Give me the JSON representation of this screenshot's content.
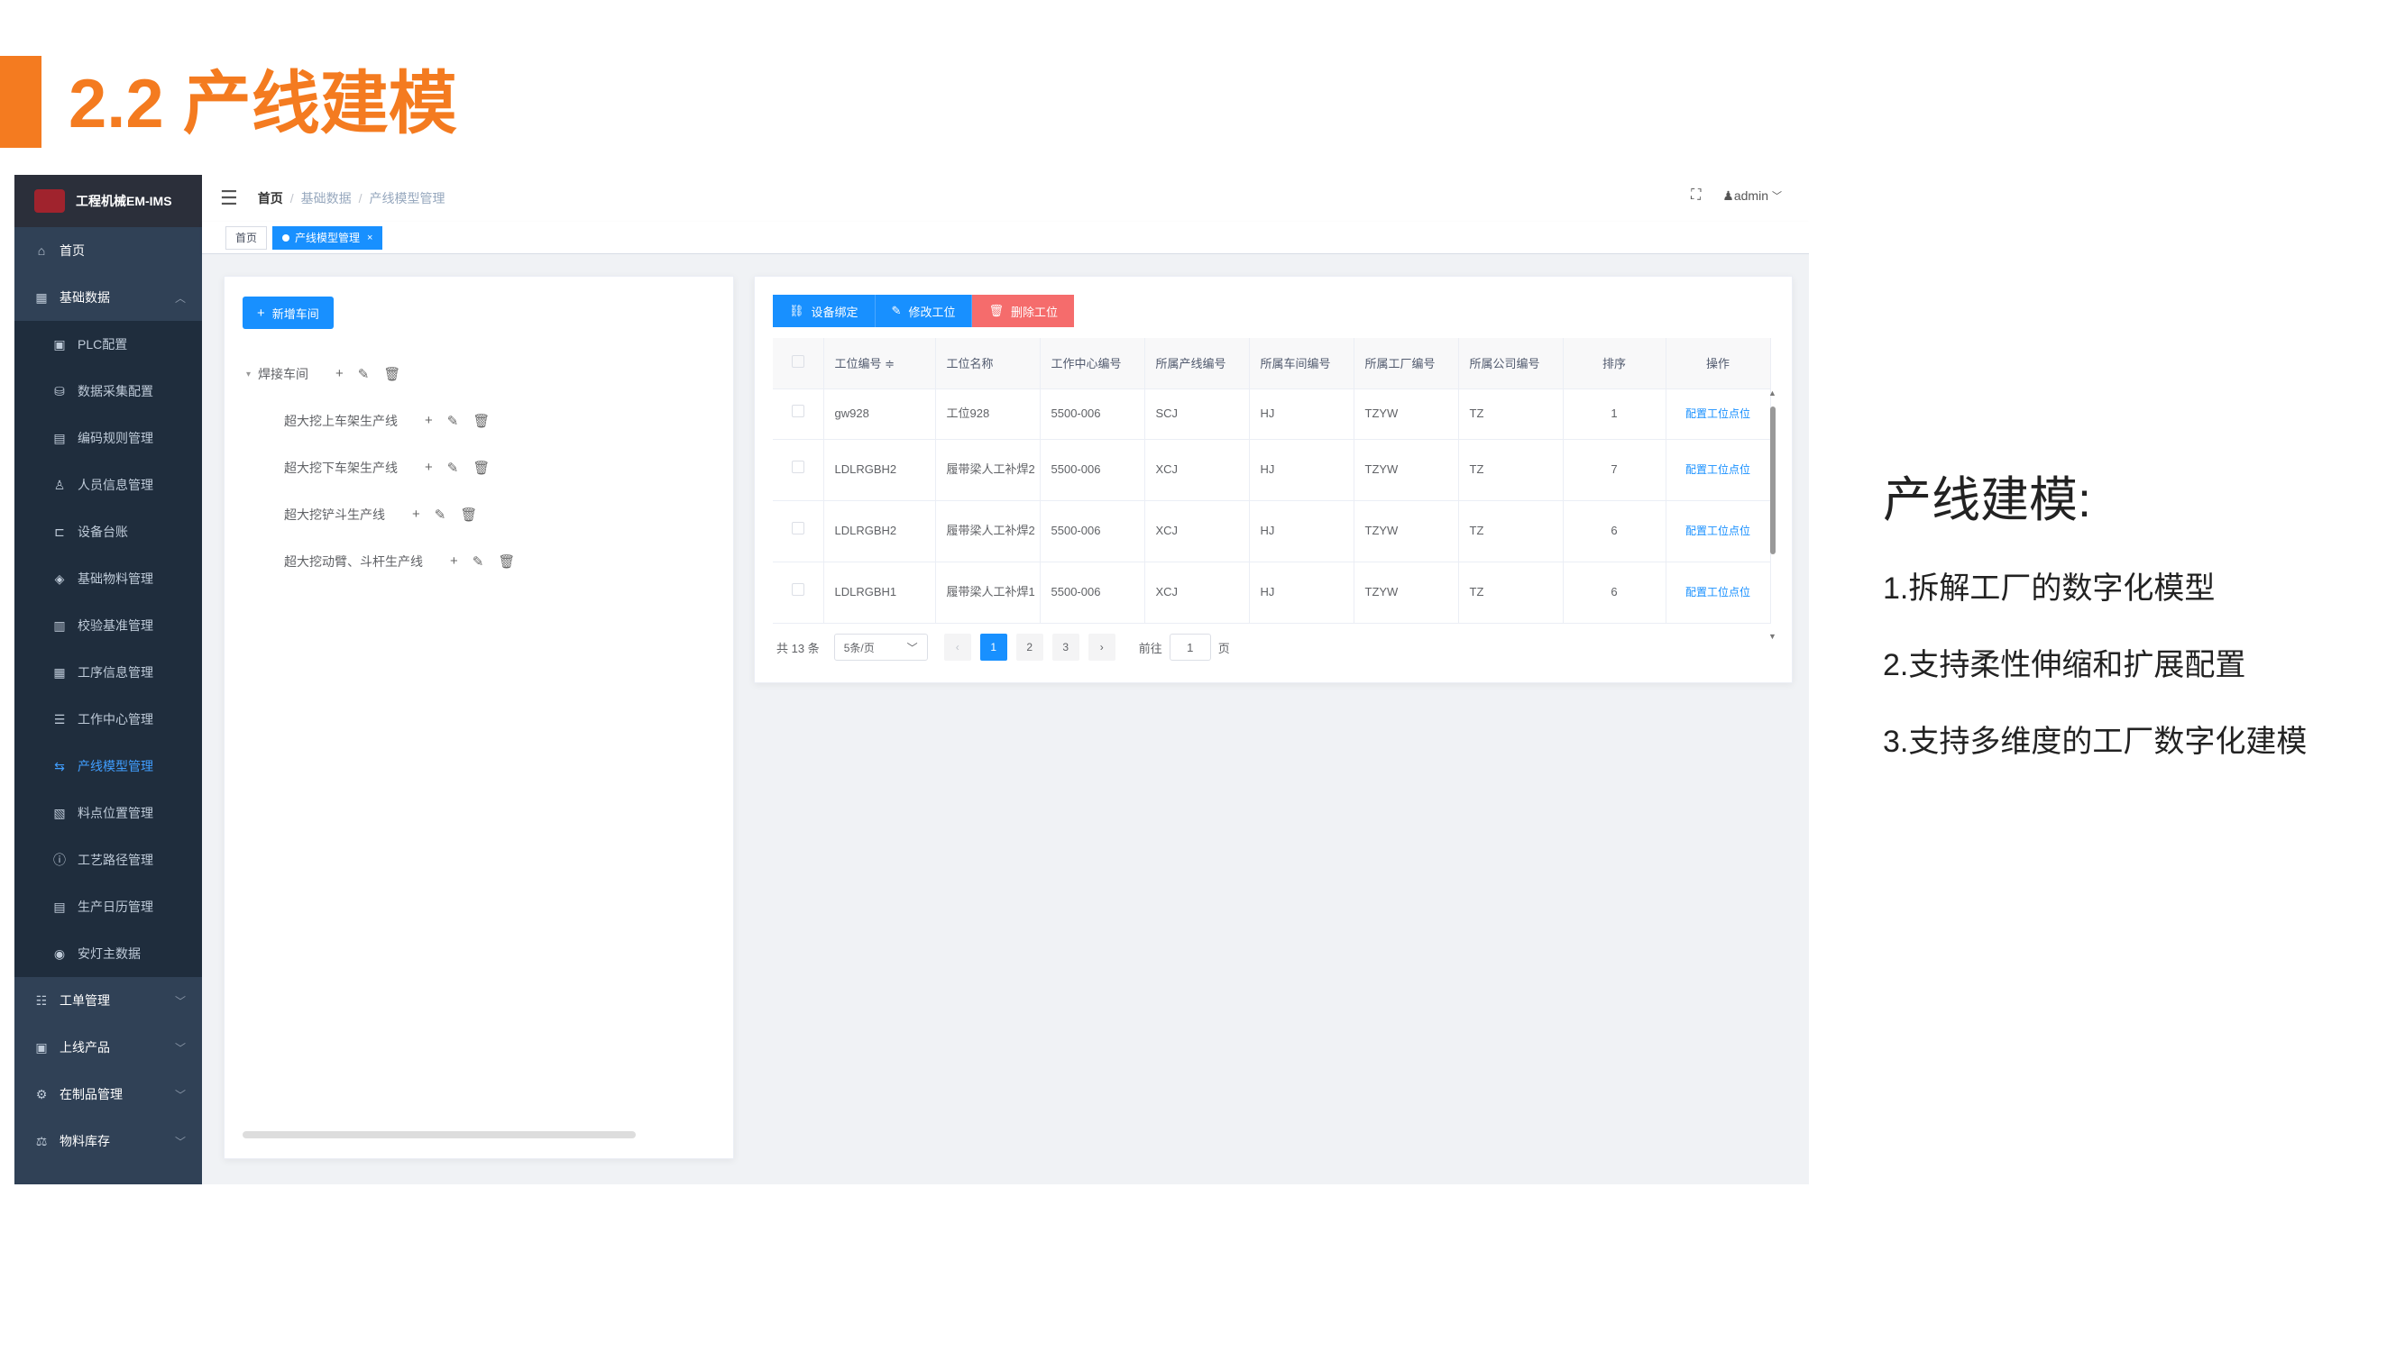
{
  "slide": {
    "title": "2.2 产线建模",
    "info_title": "产线建模:",
    "info_items": [
      "1.拆解工厂的数字化模型",
      "2.支持柔性伸缩和扩展配置",
      "3.支持多维度的工厂数字化建模"
    ],
    "accent_color": "#f47b20"
  },
  "app": {
    "logo_text": "工程机械EM-IMS",
    "breadcrumb": [
      "首页",
      "基础数据",
      "产线模型管理"
    ],
    "user": "admin",
    "tags": [
      "首页",
      "产线模型管理"
    ],
    "sidebar": {
      "top_items": [
        {
          "label": "首页",
          "icon": "home-icon"
        },
        {
          "label": "基础数据",
          "icon": "grid-icon"
        }
      ],
      "sub_items": [
        {
          "label": "PLC配置",
          "icon": "plc-icon"
        },
        {
          "label": "数据采集配置",
          "icon": "database-icon"
        },
        {
          "label": "编码规则管理",
          "icon": "code-icon"
        },
        {
          "label": "人员信息管理",
          "icon": "user-icon"
        },
        {
          "label": "设备台账",
          "icon": "device-icon"
        },
        {
          "label": "基础物料管理",
          "icon": "material-icon"
        },
        {
          "label": "校验基准管理",
          "icon": "check-icon"
        },
        {
          "label": "工序信息管理",
          "icon": "process-icon"
        },
        {
          "label": "工作中心管理",
          "icon": "workcenter-icon"
        },
        {
          "label": "产线模型管理",
          "icon": "line-icon"
        },
        {
          "label": "料点位置管理",
          "icon": "location-icon"
        },
        {
          "label": "工艺路径管理",
          "icon": "route-icon"
        },
        {
          "label": "生产日历管理",
          "icon": "calendar-icon"
        },
        {
          "label": "安灯主数据",
          "icon": "andon-icon"
        }
      ],
      "bottom_items": [
        {
          "label": "工单管理",
          "icon": "order-icon"
        },
        {
          "label": "上线产品",
          "icon": "product-icon"
        },
        {
          "label": "在制品管理",
          "icon": "wip-icon"
        },
        {
          "label": "物料库存",
          "icon": "stock-icon"
        }
      ]
    },
    "tree_panel": {
      "add_button": "新增车间",
      "root": "焊接车间",
      "children": [
        "超大挖上车架生产线",
        "超大挖下车架生产线",
        "超大挖铲斗生产线",
        "超大挖动臂、斗杆生产线"
      ]
    },
    "toolbar": {
      "bind": "设备绑定",
      "edit": "修改工位",
      "delete": "删除工位"
    },
    "table": {
      "headers": [
        "工位编号",
        "工位名称",
        "工作中心编号",
        "所属产线编号",
        "所属车间编号",
        "所属工厂编号",
        "所属公司编号",
        "排序",
        "操作"
      ],
      "sort_mark": "≑",
      "rows": [
        [
          "gw928",
          "工位928",
          "5500-006",
          "SCJ",
          "HJ",
          "TZYW",
          "TZ",
          "1",
          "配置工位点位"
        ],
        [
          "LDLRGBH2",
          "履带梁人工补焊2",
          "5500-006",
          "XCJ",
          "HJ",
          "TZYW",
          "TZ",
          "7",
          "配置工位点位"
        ],
        [
          "LDLRGBH2",
          "履带梁人工补焊2",
          "5500-006",
          "XCJ",
          "HJ",
          "TZYW",
          "TZ",
          "6",
          "配置工位点位"
        ],
        [
          "LDLRGBH1",
          "履带梁人工补焊1",
          "5500-006",
          "XCJ",
          "HJ",
          "TZYW",
          "TZ",
          "6",
          "配置工位点位"
        ]
      ]
    },
    "pagination": {
      "total": "共 13 条",
      "page_size": "5条/页",
      "pages": [
        "1",
        "2",
        "3"
      ],
      "goto_label": "前往",
      "goto_value": "1",
      "goto_suffix": "页"
    }
  }
}
